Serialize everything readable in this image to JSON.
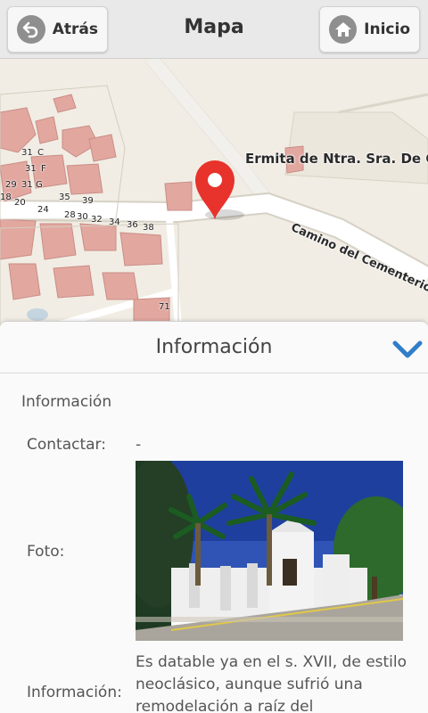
{
  "header": {
    "title": "Mapa",
    "back_label": "Atrás",
    "home_label": "Inicio"
  },
  "map": {
    "place_label": "Ermita de Ntra. Sra. De C",
    "road_label": "Camino del Cementerio",
    "house_numbers": [
      "31",
      "C",
      "31",
      "F",
      "29",
      "31",
      "G",
      "18",
      "20",
      "24",
      "35",
      "39",
      "28",
      "30",
      "32",
      "34",
      "36",
      "38",
      "71"
    ],
    "colors": {
      "background": "#f1ede4",
      "building": "#e2a8a0",
      "road": "#ffffff",
      "marker": "#e8322c"
    }
  },
  "panel": {
    "title": "Información",
    "section_title": "Información",
    "contact_label": "Contactar:",
    "contact_value": "-",
    "photo_label": "Foto:",
    "info_label": "Información:",
    "info_text": "Es datable ya en el s. XVII, de estilo neoclásico, aunque sufrió una remodelación a raíz del"
  },
  "icons": {
    "back": "back-arrow-icon",
    "home": "home-icon",
    "marker": "map-marker-icon",
    "collapse": "chevron-down-icon"
  }
}
